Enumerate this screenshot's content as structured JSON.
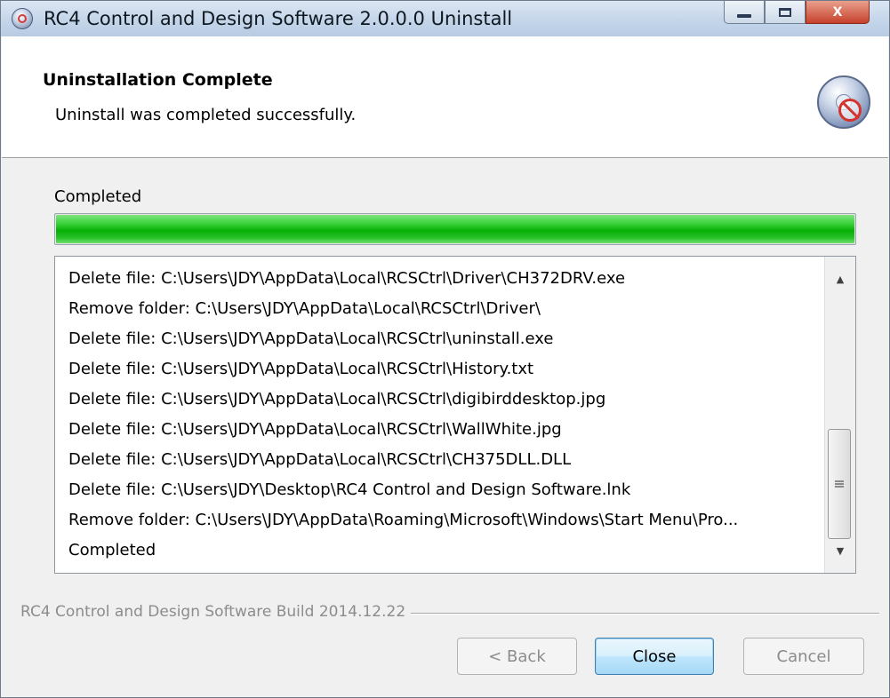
{
  "window": {
    "title": "RC4 Control and Design Software 2.0.0.0 Uninstall",
    "close_glyph": "X"
  },
  "header": {
    "title": "Uninstallation Complete",
    "subtitle": "Uninstall was completed successfully.",
    "icon": "uninstall-cd-icon"
  },
  "progress": {
    "label": "Completed",
    "percent": 100,
    "color": "#06b006"
  },
  "log": {
    "lines": [
      "Delete file: C:\\Users\\JDY\\AppData\\Local\\RCSCtrl\\Driver\\CH372DRV.exe",
      "Remove folder: C:\\Users\\JDY\\AppData\\Local\\RCSCtrl\\Driver\\",
      "Delete file: C:\\Users\\JDY\\AppData\\Local\\RCSCtrl\\uninstall.exe",
      "Delete file: C:\\Users\\JDY\\AppData\\Local\\RCSCtrl\\History.txt",
      "Delete file: C:\\Users\\JDY\\AppData\\Local\\RCSCtrl\\digibirddesktop.jpg",
      "Delete file: C:\\Users\\JDY\\AppData\\Local\\RCSCtrl\\WallWhite.jpg",
      "Delete file: C:\\Users\\JDY\\AppData\\Local\\RCSCtrl\\CH375DLL.DLL",
      "Delete file: C:\\Users\\JDY\\Desktop\\RC4 Control and Design Software.lnk",
      "Remove folder: C:\\Users\\JDY\\AppData\\Roaming\\Microsoft\\Windows\\Start Menu\\Pro...",
      "Completed"
    ]
  },
  "footer": {
    "brand": "RC4 Control and Design Software Build 2014.12.22",
    "back_label": "< Back",
    "close_label": "Close",
    "cancel_label": "Cancel"
  },
  "colors": {
    "titlebar": "#c6d7ea",
    "close_button": "#c7412c",
    "default_button_border": "#3c7fb1"
  }
}
